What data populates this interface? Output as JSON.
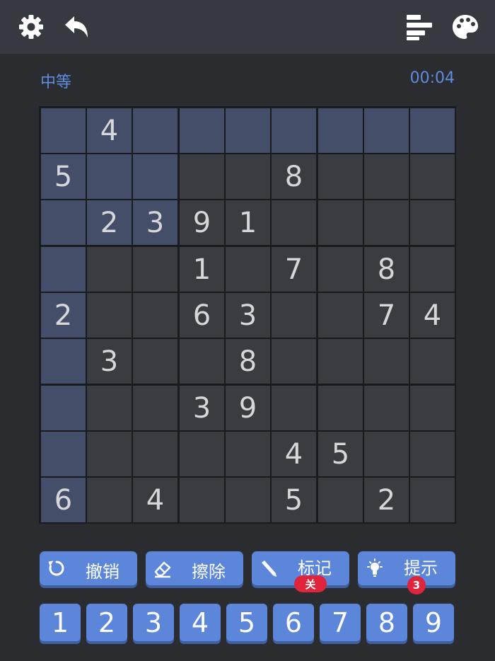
{
  "header": {
    "icons": [
      "gear-icon",
      "undo-arrow-icon",
      "stats-bars-icon",
      "palette-icon"
    ]
  },
  "info": {
    "difficulty": "中等",
    "timer": "00:04"
  },
  "board": {
    "grid": [
      [
        "",
        "4",
        "",
        "",
        "",
        "",
        "",
        "",
        ""
      ],
      [
        "5",
        "",
        "",
        "",
        "",
        "8",
        "",
        "",
        ""
      ],
      [
        "",
        "2",
        "3",
        "9",
        "1",
        "",
        "",
        "",
        ""
      ],
      [
        "",
        "",
        "",
        "1",
        "",
        "7",
        "",
        "8",
        ""
      ],
      [
        "2",
        "",
        "",
        "6",
        "3",
        "",
        "",
        "7",
        "4"
      ],
      [
        "",
        "3",
        "",
        "",
        "8",
        "",
        "",
        "",
        ""
      ],
      [
        "",
        "",
        "",
        "3",
        "9",
        "",
        "",
        "",
        ""
      ],
      [
        "",
        "",
        "",
        "",
        "",
        "4",
        "5",
        "",
        ""
      ],
      [
        "6",
        "",
        "4",
        "",
        "",
        "5",
        "",
        "2",
        ""
      ]
    ],
    "selected_row": 0,
    "selected_col": 0,
    "highlight_color": "#444e68",
    "cell_color": "#3a3c42"
  },
  "tools": [
    {
      "label": "撤销",
      "icon": "undo-circle-icon"
    },
    {
      "label": "擦除",
      "icon": "eraser-icon"
    },
    {
      "label": "标记",
      "icon": "pencil-icon",
      "badge": "关"
    },
    {
      "label": "提示",
      "icon": "lightbulb-icon",
      "badge": "3"
    }
  ],
  "numpad": [
    "1",
    "2",
    "3",
    "4",
    "5",
    "6",
    "7",
    "8",
    "9"
  ],
  "colors": {
    "accent": "#5b86d9",
    "badge": "#e0243c",
    "info_text": "#5f8de0"
  }
}
